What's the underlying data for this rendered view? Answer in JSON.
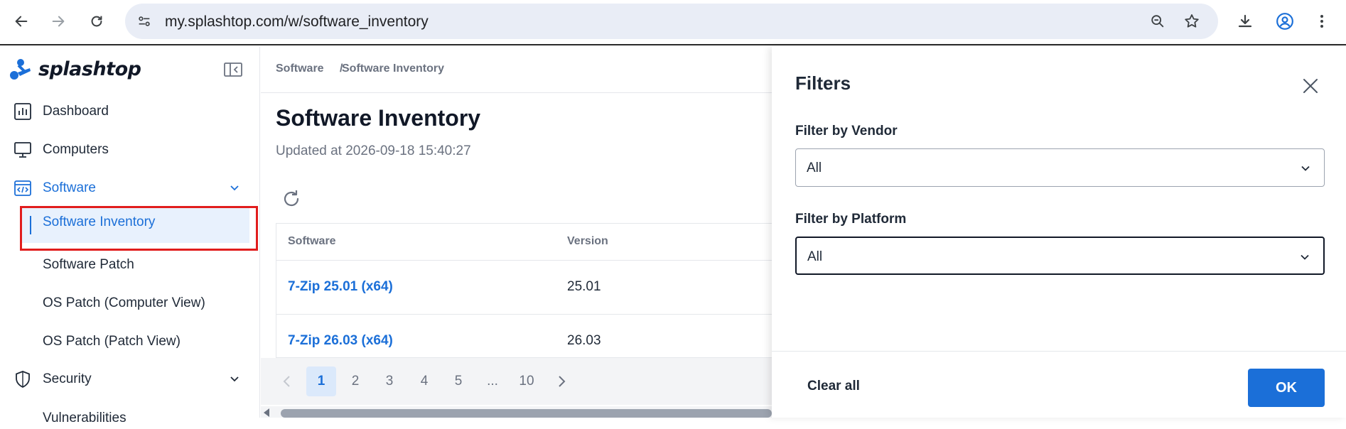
{
  "browser": {
    "url": "my.splashtop.com/w/software_inventory"
  },
  "sidebar": {
    "logo_text": "splashtop",
    "items": [
      {
        "label": "Dashboard",
        "icon": "dashboard-icon"
      },
      {
        "label": "Computers",
        "icon": "monitor-icon"
      },
      {
        "label": "Software",
        "icon": "code-window-icon",
        "expanded": true
      },
      {
        "label": "Security",
        "icon": "shield-icon",
        "expanded": false
      }
    ],
    "software_sub": [
      {
        "label": "Software Inventory",
        "active": true
      },
      {
        "label": "Software Patch"
      },
      {
        "label": "OS Patch (Computer View)"
      },
      {
        "label": "OS Patch (Patch View)"
      }
    ],
    "security_sub_partial": "Vulnerabilities"
  },
  "main": {
    "breadcrumb": {
      "parent": "Software",
      "separator": "/",
      "current": "Software Inventory"
    },
    "title": "Software Inventory",
    "updated": "Updated at 2026-09-18 15:40:27",
    "table": {
      "columns": [
        "Software",
        "Version"
      ],
      "rows": [
        {
          "software": "7-Zip 25.01 (x64)",
          "version": "25.01"
        },
        {
          "software": "7-Zip 26.03 (x64)",
          "version": "26.03"
        }
      ]
    },
    "pagination": {
      "pages": [
        "1",
        "2",
        "3",
        "4",
        "5",
        "...",
        "10"
      ],
      "current": "1"
    }
  },
  "filters": {
    "title": "Filters",
    "vendor_label": "Filter by Vendor",
    "vendor_value": "All",
    "platform_label": "Filter by Platform",
    "platform_value": "All",
    "clear_all": "Clear all",
    "ok": "OK"
  },
  "colors": {
    "accent": "#1b6fd8",
    "highlight_box": "#e11d1d"
  }
}
